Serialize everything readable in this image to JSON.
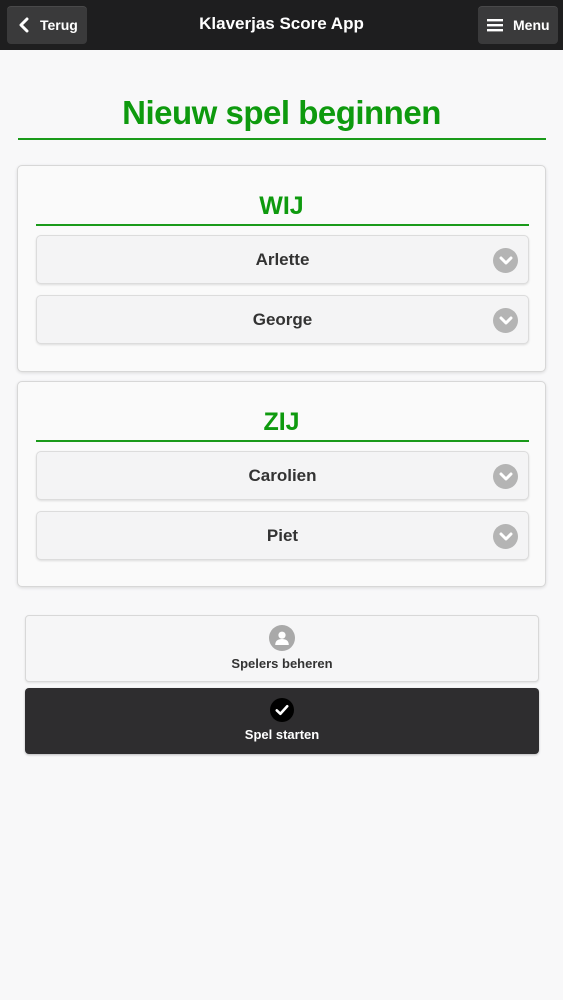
{
  "header": {
    "back_label": "Terug",
    "title": "Klaverjas Score App",
    "menu_label": "Menu"
  },
  "page": {
    "title": "Nieuw spel beginnen"
  },
  "teams": [
    {
      "label": "WIJ",
      "players": [
        "Arlette",
        "George"
      ]
    },
    {
      "label": "ZIJ",
      "players": [
        "Carolien",
        "Piet"
      ]
    }
  ],
  "actions": {
    "manage_players_label": "Spelers beheren",
    "start_game_label": "Spel starten"
  },
  "colors": {
    "accent": "#0e9a0e",
    "header_bg": "#1e1e1f",
    "primary_button_bg": "#2e2d2f"
  },
  "icons": {
    "back": "chevron-left-icon",
    "menu": "hamburger-icon",
    "select": "chevron-down-icon",
    "manage": "user-icon",
    "start": "checkmark-icon"
  }
}
